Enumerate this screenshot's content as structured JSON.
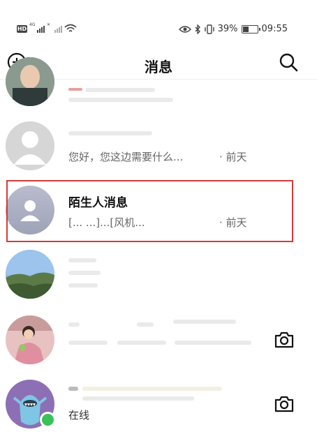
{
  "status_bar": {
    "hd": "HD",
    "network_1": "4G",
    "network_2": "✕",
    "battery_percent": "39%",
    "battery_level": 0.39,
    "time": "09:55"
  },
  "header": {
    "title": "消息",
    "left_icon": "plus-circle-icon",
    "right_icon": "search-icon"
  },
  "conversations": [
    {
      "name": "",
      "preview": "",
      "time": ""
    },
    {
      "name": "",
      "preview": "您好，您这边需要什么...",
      "time": "· 前天"
    },
    {
      "name": "陌生人消息",
      "preview": "[...  ...]...[风机...",
      "time": "· 前天"
    },
    {
      "name": "",
      "preview": "",
      "time": ""
    },
    {
      "name": "",
      "preview": "",
      "time": ""
    },
    {
      "name": "",
      "preview": "在线",
      "time": ""
    }
  ],
  "colors": {
    "highlight": "#d23a3a",
    "online": "#39c25a"
  }
}
